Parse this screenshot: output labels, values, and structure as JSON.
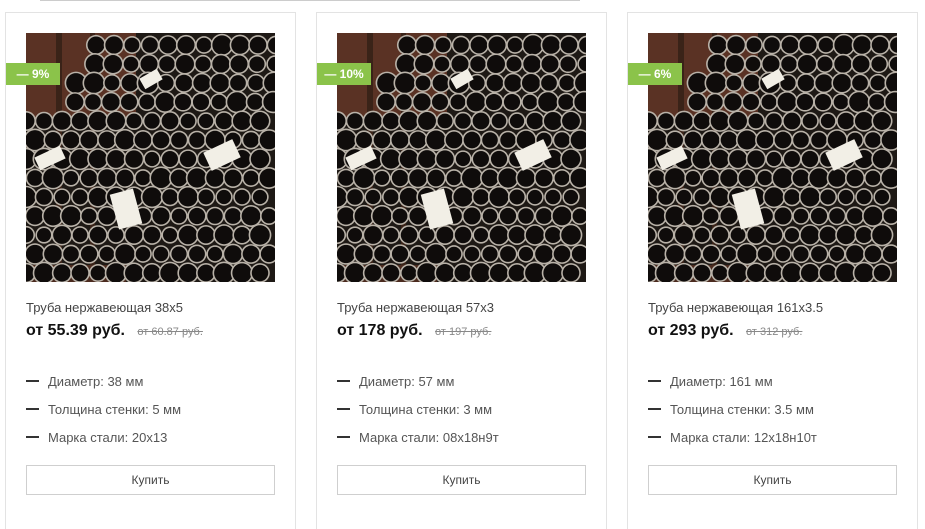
{
  "accent_color": "#8bc34a",
  "products": [
    {
      "image_icon": "steel-pipes-photo",
      "discount": "— 9%",
      "title": "Труба нержавеющая 38х5",
      "price": "от 55.39 руб.",
      "old_price": "от 60.87 руб.",
      "props": [
        {
          "label": "Диаметр:",
          "value": "38 мм"
        },
        {
          "label": "Толщина стенки:",
          "value": "5 мм"
        },
        {
          "label": "Марка стали:",
          "value": "20х13"
        }
      ],
      "buy_label": "Купить"
    },
    {
      "image_icon": "steel-pipes-photo",
      "discount": "— 10%",
      "title": "Труба нержавеющая 57х3",
      "price": "от 178 руб.",
      "old_price": "от 197 руб.",
      "props": [
        {
          "label": "Диаметр:",
          "value": "57 мм"
        },
        {
          "label": "Толщина стенки:",
          "value": "3 мм"
        },
        {
          "label": "Марка стали:",
          "value": "08х18н9т"
        }
      ],
      "buy_label": "Купить"
    },
    {
      "image_icon": "steel-pipes-photo",
      "discount": "— 6%",
      "title": "Труба нержавеющая 161х3.5",
      "price": "от 293 руб.",
      "old_price": "от 312 руб.",
      "props": [
        {
          "label": "Диаметр:",
          "value": "161 мм"
        },
        {
          "label": "Толщина стенки:",
          "value": "3.5 мм"
        },
        {
          "label": "Марка стали:",
          "value": "12х18н10т"
        }
      ],
      "buy_label": "Купить"
    }
  ]
}
